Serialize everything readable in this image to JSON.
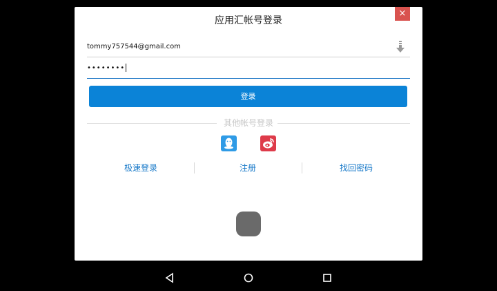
{
  "dialog": {
    "title": "应用汇帐号登录",
    "close_label": "×"
  },
  "form": {
    "email_value": "tommy757544@gmail.com",
    "password_value": "••••••••"
  },
  "login_button_label": "登录",
  "other_login_label": "其他帐号登录",
  "social": [
    "qq-icon",
    "weibo-icon"
  ],
  "links": {
    "fast_login": "极速登录",
    "register": "注册",
    "recover_password": "找回密码"
  },
  "colors": {
    "primary": "#0b83d7",
    "close": "#d9534f",
    "link": "#1678c8"
  }
}
